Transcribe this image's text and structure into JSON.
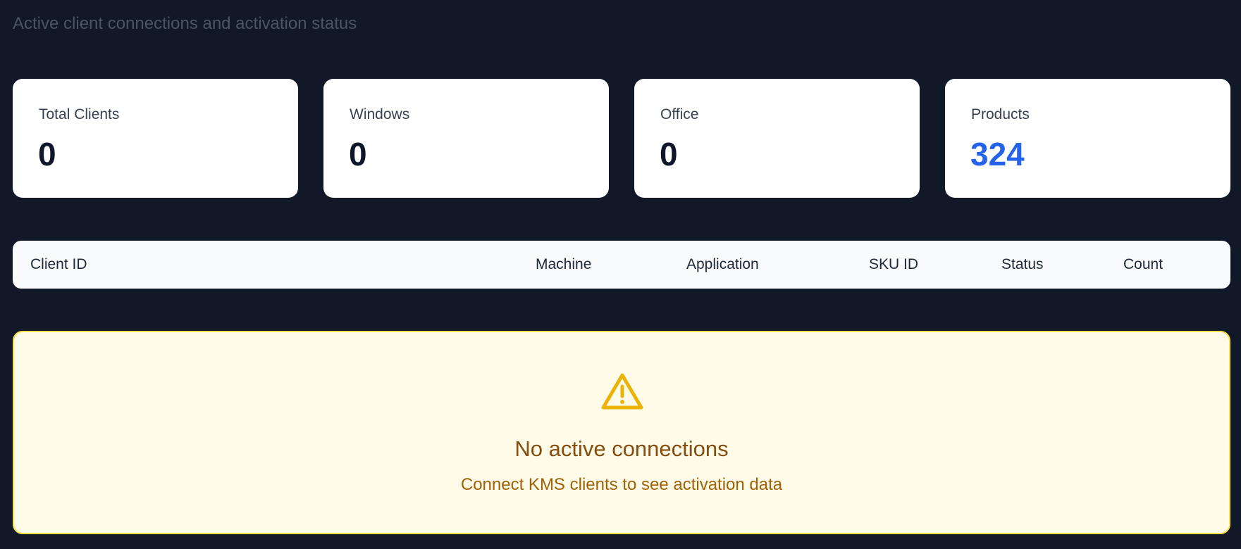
{
  "header": {
    "subtitle": "Active client connections and activation status"
  },
  "stats": [
    {
      "label": "Total Clients",
      "value": "0"
    },
    {
      "label": "Windows",
      "value": "0"
    },
    {
      "label": "Office",
      "value": "0"
    },
    {
      "label": "Products",
      "value": "324",
      "color": "#2563eb"
    }
  ],
  "table": {
    "columns": [
      "Client ID",
      "Machine",
      "Application",
      "SKU ID",
      "Status",
      "Count"
    ]
  },
  "empty_state": {
    "icon": "warning-triangle-icon",
    "title": "No active connections",
    "message": "Connect KMS clients to see activation data"
  },
  "colors": {
    "background": "#111827",
    "accent": "#2563eb",
    "warning": "#eab308",
    "warning_bg": "#fefbe8"
  }
}
